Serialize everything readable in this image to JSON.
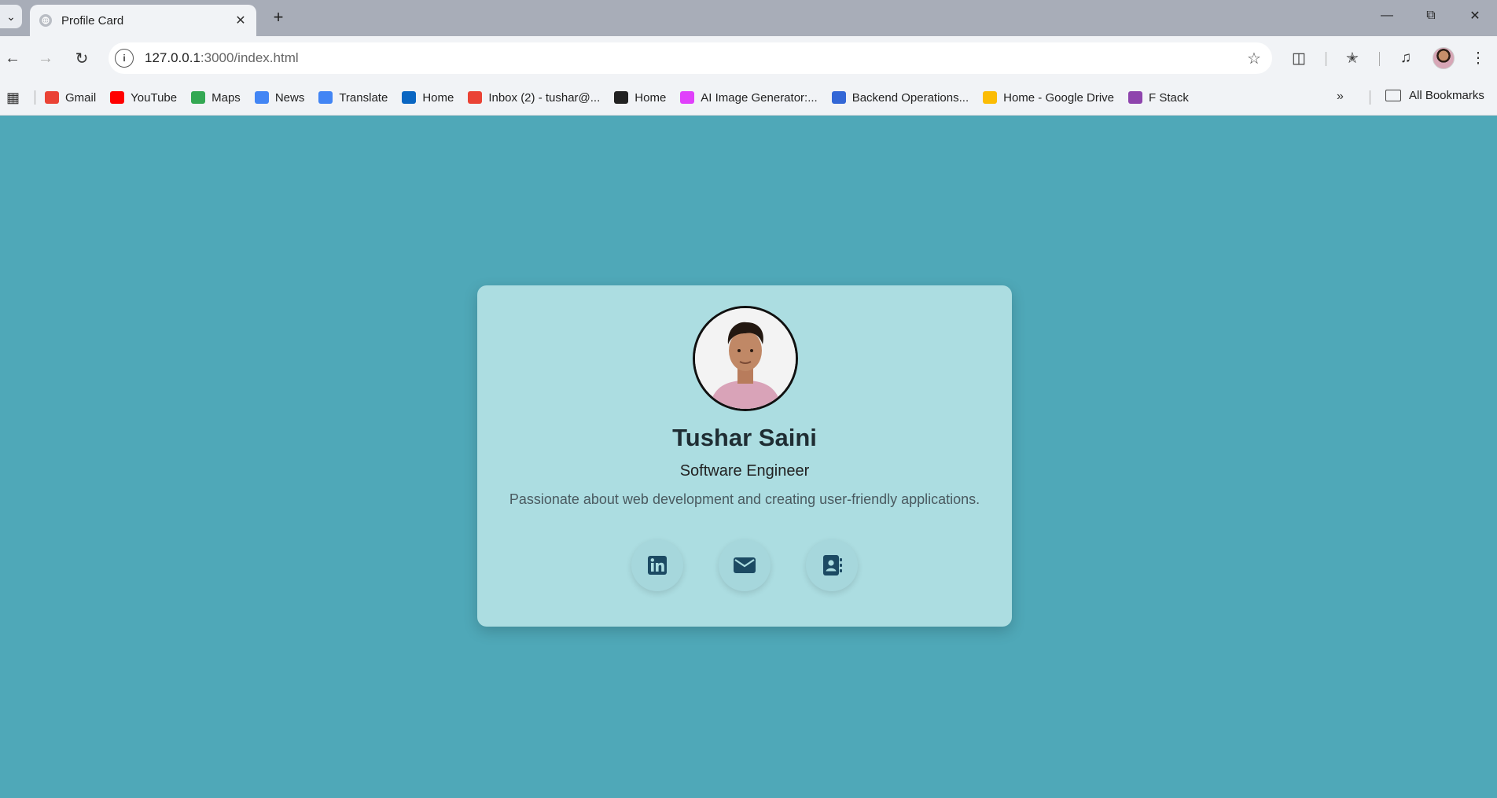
{
  "browser": {
    "tab_title": "Profile Card",
    "url_host": "127.0.0.1",
    "url_rest": ":3000/index.html"
  },
  "bookmarks": [
    {
      "label": "Gmail",
      "icon": "gmail-icon",
      "color": "#ea4335"
    },
    {
      "label": "YouTube",
      "icon": "youtube-icon",
      "color": "#ff0000"
    },
    {
      "label": "Maps",
      "icon": "maps-icon",
      "color": "#34a853"
    },
    {
      "label": "News",
      "icon": "news-icon",
      "color": "#4285f4"
    },
    {
      "label": "Translate",
      "icon": "translate-icon",
      "color": "#4285f4"
    },
    {
      "label": "Home",
      "icon": "linkedin-icon",
      "color": "#0a66c2"
    },
    {
      "label": "Inbox (2) - tushar@...",
      "icon": "gmail-icon",
      "color": "#ea4335"
    },
    {
      "label": "Home",
      "icon": "globe-icon",
      "color": "#222222"
    },
    {
      "label": "AI Image Generator:...",
      "icon": "ai-generator-icon",
      "color": "#e040fb"
    },
    {
      "label": "Backend Operations...",
      "icon": "backend-icon",
      "color": "#3367d6"
    },
    {
      "label": "Home - Google Drive",
      "icon": "google-drive-icon",
      "color": "#fbbc04"
    },
    {
      "label": "F Stack",
      "icon": "fstack-icon",
      "color": "#8e44ad"
    }
  ],
  "all_bookmarks_label": "All Bookmarks",
  "profile": {
    "name": "Tushar Saini",
    "role": "Software Engineer",
    "bio": "Passionate about web development and creating user-friendly applications."
  },
  "colors": {
    "page_bg": "#4fa8b8",
    "card_bg": "#acdde1",
    "icon_color": "#1c4a63"
  }
}
